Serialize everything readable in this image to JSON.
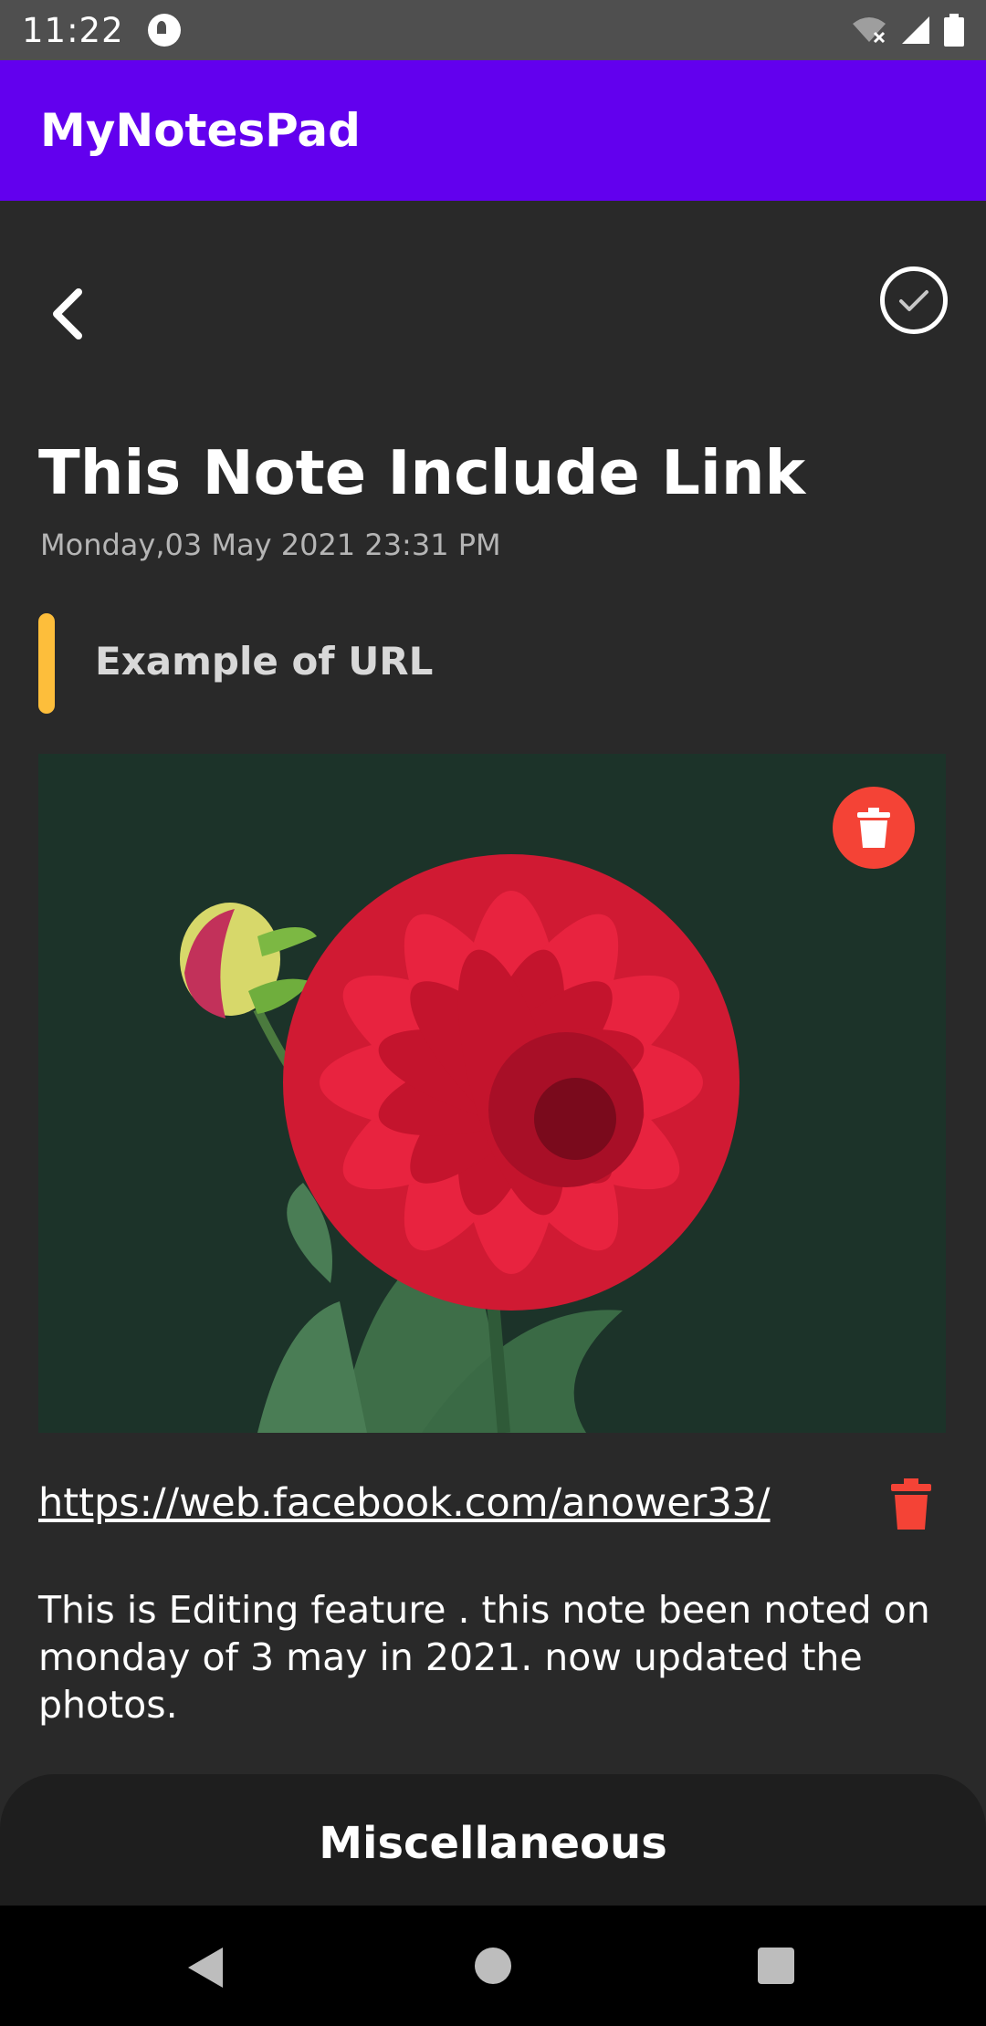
{
  "status_bar": {
    "time": "11:22",
    "icons": [
      "app-notification-icon",
      "wifi-off-icon",
      "signal-icon",
      "battery-icon"
    ]
  },
  "app_bar": {
    "title": "MyNotesPad",
    "color": "#6200ee"
  },
  "toolbar": {
    "back_icon": "chevron-left-icon",
    "save_icon": "check-circle-icon"
  },
  "note": {
    "title": "This Note Include Link",
    "date": "Monday,03 May 2021 23:31 PM",
    "subtitle": "Example of URL",
    "subtitle_accent_color": "#fdbe3b",
    "image": {
      "description_icon": "red-dahlia-photo",
      "delete_icon": "trash-icon"
    },
    "url": "https://web.facebook.com/anower33/",
    "url_delete_icon": "trash-icon",
    "text": "This is Editing feature . this note been noted on monday of 3 may in 2021. now updated the photos."
  },
  "misc": {
    "title": "Miscellaneous"
  },
  "nav_bar": {
    "icons": [
      "nav-back-icon",
      "nav-home-icon",
      "nav-recents-icon"
    ]
  }
}
